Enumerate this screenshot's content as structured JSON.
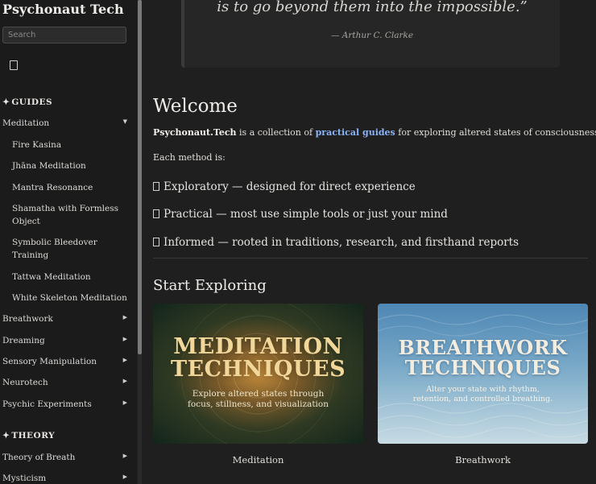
{
  "sidebar": {
    "title": "Psychonaut Tech",
    "search_placeholder": "Search",
    "guides_heading": "GUIDES",
    "theory_heading": "THEORY",
    "meditation": {
      "label": "Meditation",
      "children": [
        "Fire Kasina",
        "Jhāna Meditation",
        "Mantra Resonance",
        "Shamatha with Formless Object",
        "Symbolic Bleedover Training",
        "Tattwa Meditation",
        "White Skeleton Meditation"
      ]
    },
    "guide_items": [
      "Breathwork",
      "Dreaming",
      "Sensory Manipulation",
      "Neurotech",
      "Psychic Experiments"
    ],
    "theory_items": [
      "Theory of Breath",
      "Mysticism"
    ]
  },
  "quote": {
    "line": "is to go beyond them into the impossible.”",
    "attribution": "— Arthur C. Clarke"
  },
  "main": {
    "welcome_heading": "Welcome",
    "intro_brand": "Psychonaut.Tech",
    "intro_mid": " is a collection of ",
    "intro_link": "practical guides",
    "intro_end": " for exploring altered states of consciousness.",
    "each_method": "Each method is:",
    "bullets": [
      "Exploratory — designed for direct experience",
      "Practical — most use simple tools or just your mind",
      "Informed — rooted in traditions, research, and firsthand reports"
    ],
    "start_heading": "Start Exploring",
    "cards": [
      {
        "title_line1": "MEDITATION",
        "title_line2": "TECHNIQUES",
        "sub_line1": "Explore altered states through",
        "sub_line2": "focus, stillness, and visualization",
        "label": "Meditation"
      },
      {
        "title_line1": "BREATHWORK",
        "title_line2": "TECHNIQUES",
        "sub_line1": "Alter your state with rhythm,",
        "sub_line2": "retention, and controlled breathing.",
        "label": "Breathwork"
      }
    ]
  }
}
